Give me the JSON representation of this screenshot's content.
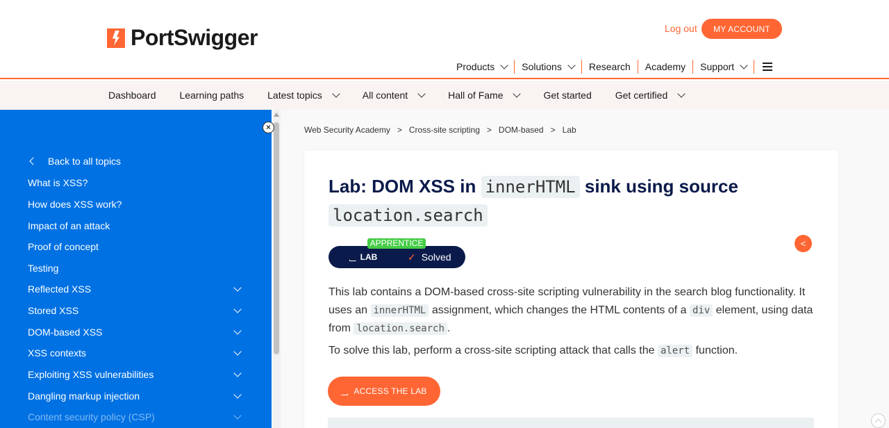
{
  "header": {
    "brand": "PortSwigger",
    "logout": "Log out",
    "my_account": "MY ACCOUNT",
    "nav": [
      {
        "label": "Products",
        "dropdown": true
      },
      {
        "label": "Solutions",
        "dropdown": true
      },
      {
        "label": "Research",
        "dropdown": false
      },
      {
        "label": "Academy",
        "dropdown": false
      },
      {
        "label": "Support",
        "dropdown": true
      }
    ]
  },
  "subnav": [
    {
      "label": "Dashboard",
      "dropdown": false
    },
    {
      "label": "Learning paths",
      "dropdown": false
    },
    {
      "label": "Latest topics",
      "dropdown": true
    },
    {
      "label": "All content",
      "dropdown": true
    },
    {
      "label": "Hall of Fame",
      "dropdown": true
    },
    {
      "label": "Get started",
      "dropdown": false
    },
    {
      "label": "Get certified",
      "dropdown": true
    }
  ],
  "sidebar": {
    "back": "Back to all topics",
    "items": [
      {
        "label": "What is XSS?",
        "expand": false
      },
      {
        "label": "How does XSS work?",
        "expand": false
      },
      {
        "label": "Impact of an attack",
        "expand": false
      },
      {
        "label": "Proof of concept",
        "expand": false
      },
      {
        "label": "Testing",
        "expand": false
      },
      {
        "label": "Reflected XSS",
        "expand": true
      },
      {
        "label": "Stored XSS",
        "expand": true
      },
      {
        "label": "DOM-based XSS",
        "expand": true
      },
      {
        "label": "XSS contexts",
        "expand": true
      },
      {
        "label": "Exploiting XSS vulnerabilities",
        "expand": true
      },
      {
        "label": "Dangling markup injection",
        "expand": true
      },
      {
        "label": "Content security policy (CSP)",
        "expand": true
      }
    ]
  },
  "breadcrumb": [
    "Web Security Academy",
    "Cross-site scripting",
    "DOM-based",
    "Lab"
  ],
  "breadcrumb_sep": ">",
  "lab": {
    "title_prefix": "Lab: DOM XSS in",
    "title_code1": "innerHTML",
    "title_mid": "sink using source",
    "title_code2": "location.search",
    "level": "APPRENTICE",
    "lab_label": "LAB",
    "status": "Solved",
    "desc_1": "This lab contains a DOM-based cross-site scripting vulnerability in the search blog functionality. It uses an",
    "desc_code1": "innerHTML",
    "desc_2": "assignment, which changes the HTML contents of a",
    "desc_code2": "div",
    "desc_3": "element, using data from",
    "desc_code3": "location.search",
    "desc_4": ".",
    "solve_1": "To solve this lab, perform a cross-site scripting attack that calls the",
    "solve_code": "alert",
    "solve_2": "function.",
    "access_button": "ACCESS THE LAB"
  },
  "colors": {
    "accent": "#ff6633",
    "sidebar": "#0071e3",
    "navy": "#0a1a4a",
    "level_green": "#44cc44"
  }
}
